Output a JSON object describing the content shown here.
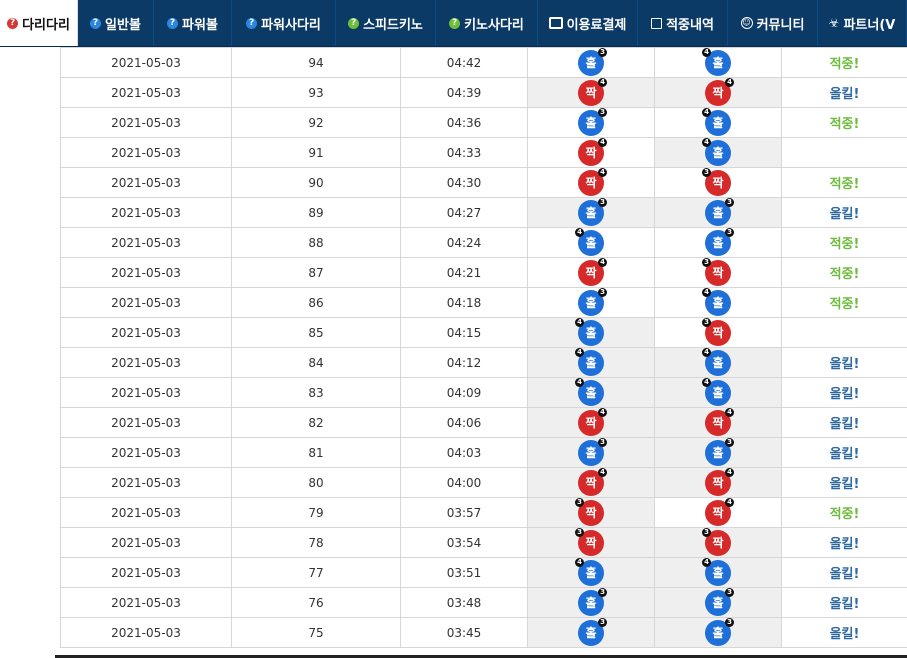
{
  "nav": {
    "tabs": [
      {
        "label": "다리다리",
        "icon": "question-circle-icon",
        "icon_color": "#d23a3a",
        "active": true,
        "width": 78
      },
      {
        "label": "일반볼",
        "icon": "question-circle-icon",
        "icon_color": "#2b86e0",
        "active": false,
        "width": 76
      },
      {
        "label": "파워볼",
        "icon": "question-circle-icon",
        "icon_color": "#2b86e0",
        "active": false,
        "width": 78
      },
      {
        "label": "파워사다리",
        "icon": "question-circle-icon",
        "icon_color": "#2b86e0",
        "active": false,
        "width": 104
      },
      {
        "label": "스피드키노",
        "icon": "question-circle-icon",
        "icon_color": "#6fbe3a",
        "active": false,
        "width": 100
      },
      {
        "label": "키노사다리",
        "icon": "question-circle-icon",
        "icon_color": "#6fbe3a",
        "active": false,
        "width": 102
      },
      {
        "label": "이용료결제",
        "icon": "database-icon",
        "active": false,
        "width": 100
      },
      {
        "label": "적중내역",
        "icon": "check-square-icon",
        "active": false,
        "width": 90
      },
      {
        "label": "커뮤니티",
        "icon": "smile-icon",
        "active": false,
        "width": 90
      },
      {
        "label": "파트너(V",
        "icon": "biohazard-icon",
        "active": false,
        "width": 89
      }
    ]
  },
  "colors": {
    "nav_bg": "#0b3a66",
    "odd_ball": "#1f6fd8",
    "even_ball": "#d62a2a",
    "hit": "#6dbb3c",
    "kill": "#2e6aa0"
  },
  "rows": [
    {
      "date": "2021-05-03",
      "round": "94",
      "time": "04:42",
      "r1": {
        "text": "홀",
        "color": "blue",
        "num": "3",
        "pos": "right"
      },
      "r2": {
        "text": "홀",
        "color": "blue",
        "num": "4",
        "pos": "left"
      },
      "r1_gray": false,
      "r2_gray": false,
      "result": "적중!",
      "result_type": "hit"
    },
    {
      "date": "2021-05-03",
      "round": "93",
      "time": "04:39",
      "r1": {
        "text": "짝",
        "color": "red",
        "num": "4",
        "pos": "right"
      },
      "r2": {
        "text": "짝",
        "color": "red",
        "num": "4",
        "pos": "right"
      },
      "r1_gray": true,
      "r2_gray": true,
      "result": "올킬!",
      "result_type": "kill"
    },
    {
      "date": "2021-05-03",
      "round": "92",
      "time": "04:36",
      "r1": {
        "text": "홀",
        "color": "blue",
        "num": "3",
        "pos": "right"
      },
      "r2": {
        "text": "홀",
        "color": "blue",
        "num": "4",
        "pos": "left"
      },
      "r1_gray": false,
      "r2_gray": false,
      "result": "적중!",
      "result_type": "hit"
    },
    {
      "date": "2021-05-03",
      "round": "91",
      "time": "04:33",
      "r1": {
        "text": "짝",
        "color": "red",
        "num": "4",
        "pos": "right"
      },
      "r2": {
        "text": "홀",
        "color": "blue",
        "num": "4",
        "pos": "left"
      },
      "r1_gray": false,
      "r2_gray": true,
      "result": "",
      "result_type": "none"
    },
    {
      "date": "2021-05-03",
      "round": "90",
      "time": "04:30",
      "r1": {
        "text": "짝",
        "color": "red",
        "num": "4",
        "pos": "right"
      },
      "r2": {
        "text": "짝",
        "color": "red",
        "num": "3",
        "pos": "left"
      },
      "r1_gray": false,
      "r2_gray": false,
      "result": "적중!",
      "result_type": "hit"
    },
    {
      "date": "2021-05-03",
      "round": "89",
      "time": "04:27",
      "r1": {
        "text": "홀",
        "color": "blue",
        "num": "3",
        "pos": "right"
      },
      "r2": {
        "text": "홀",
        "color": "blue",
        "num": "3",
        "pos": "right"
      },
      "r1_gray": true,
      "r2_gray": true,
      "result": "올킬!",
      "result_type": "kill"
    },
    {
      "date": "2021-05-03",
      "round": "88",
      "time": "04:24",
      "r1": {
        "text": "홀",
        "color": "blue",
        "num": "4",
        "pos": "left"
      },
      "r2": {
        "text": "홀",
        "color": "blue",
        "num": "3",
        "pos": "right"
      },
      "r1_gray": false,
      "r2_gray": false,
      "result": "적중!",
      "result_type": "hit"
    },
    {
      "date": "2021-05-03",
      "round": "87",
      "time": "04:21",
      "r1": {
        "text": "짝",
        "color": "red",
        "num": "4",
        "pos": "right"
      },
      "r2": {
        "text": "짝",
        "color": "red",
        "num": "3",
        "pos": "left"
      },
      "r1_gray": false,
      "r2_gray": false,
      "result": "적중!",
      "result_type": "hit"
    },
    {
      "date": "2021-05-03",
      "round": "86",
      "time": "04:18",
      "r1": {
        "text": "홀",
        "color": "blue",
        "num": "3",
        "pos": "right"
      },
      "r2": {
        "text": "홀",
        "color": "blue",
        "num": "4",
        "pos": "left"
      },
      "r1_gray": false,
      "r2_gray": false,
      "result": "적중!",
      "result_type": "hit"
    },
    {
      "date": "2021-05-03",
      "round": "85",
      "time": "04:15",
      "r1": {
        "text": "홀",
        "color": "blue",
        "num": "4",
        "pos": "left"
      },
      "r2": {
        "text": "짝",
        "color": "red",
        "num": "3",
        "pos": "left"
      },
      "r1_gray": true,
      "r2_gray": false,
      "result": "",
      "result_type": "none"
    },
    {
      "date": "2021-05-03",
      "round": "84",
      "time": "04:12",
      "r1": {
        "text": "홀",
        "color": "blue",
        "num": "4",
        "pos": "left"
      },
      "r2": {
        "text": "홀",
        "color": "blue",
        "num": "4",
        "pos": "left"
      },
      "r1_gray": true,
      "r2_gray": true,
      "result": "올킬!",
      "result_type": "kill"
    },
    {
      "date": "2021-05-03",
      "round": "83",
      "time": "04:09",
      "r1": {
        "text": "홀",
        "color": "blue",
        "num": "4",
        "pos": "left"
      },
      "r2": {
        "text": "홀",
        "color": "blue",
        "num": "4",
        "pos": "left"
      },
      "r1_gray": true,
      "r2_gray": true,
      "result": "올킬!",
      "result_type": "kill"
    },
    {
      "date": "2021-05-03",
      "round": "82",
      "time": "04:06",
      "r1": {
        "text": "짝",
        "color": "red",
        "num": "4",
        "pos": "right"
      },
      "r2": {
        "text": "짝",
        "color": "red",
        "num": "4",
        "pos": "right"
      },
      "r1_gray": true,
      "r2_gray": true,
      "result": "올킬!",
      "result_type": "kill"
    },
    {
      "date": "2021-05-03",
      "round": "81",
      "time": "04:03",
      "r1": {
        "text": "홀",
        "color": "blue",
        "num": "3",
        "pos": "right"
      },
      "r2": {
        "text": "홀",
        "color": "blue",
        "num": "3",
        "pos": "right"
      },
      "r1_gray": true,
      "r2_gray": true,
      "result": "올킬!",
      "result_type": "kill"
    },
    {
      "date": "2021-05-03",
      "round": "80",
      "time": "04:00",
      "r1": {
        "text": "짝",
        "color": "red",
        "num": "4",
        "pos": "right"
      },
      "r2": {
        "text": "짝",
        "color": "red",
        "num": "4",
        "pos": "right"
      },
      "r1_gray": true,
      "r2_gray": true,
      "result": "올킬!",
      "result_type": "kill"
    },
    {
      "date": "2021-05-03",
      "round": "79",
      "time": "03:57",
      "r1": {
        "text": "짝",
        "color": "red",
        "num": "3",
        "pos": "left"
      },
      "r2": {
        "text": "짝",
        "color": "red",
        "num": "4",
        "pos": "right"
      },
      "r1_gray": true,
      "r2_gray": false,
      "result": "적중!",
      "result_type": "hit"
    },
    {
      "date": "2021-05-03",
      "round": "78",
      "time": "03:54",
      "r1": {
        "text": "짝",
        "color": "red",
        "num": "3",
        "pos": "left"
      },
      "r2": {
        "text": "짝",
        "color": "red",
        "num": "3",
        "pos": "left"
      },
      "r1_gray": true,
      "r2_gray": true,
      "result": "올킬!",
      "result_type": "kill"
    },
    {
      "date": "2021-05-03",
      "round": "77",
      "time": "03:51",
      "r1": {
        "text": "홀",
        "color": "blue",
        "num": "4",
        "pos": "left"
      },
      "r2": {
        "text": "홀",
        "color": "blue",
        "num": "4",
        "pos": "left"
      },
      "r1_gray": true,
      "r2_gray": true,
      "result": "올킬!",
      "result_type": "kill"
    },
    {
      "date": "2021-05-03",
      "round": "76",
      "time": "03:48",
      "r1": {
        "text": "홀",
        "color": "blue",
        "num": "3",
        "pos": "right"
      },
      "r2": {
        "text": "홀",
        "color": "blue",
        "num": "3",
        "pos": "right"
      },
      "r1_gray": true,
      "r2_gray": true,
      "result": "올킬!",
      "result_type": "kill"
    },
    {
      "date": "2021-05-03",
      "round": "75",
      "time": "03:45",
      "r1": {
        "text": "홀",
        "color": "blue",
        "num": "3",
        "pos": "right"
      },
      "r2": {
        "text": "홀",
        "color": "blue",
        "num": "3",
        "pos": "right"
      },
      "r1_gray": true,
      "r2_gray": true,
      "result": "올킬!",
      "result_type": "kill"
    }
  ]
}
